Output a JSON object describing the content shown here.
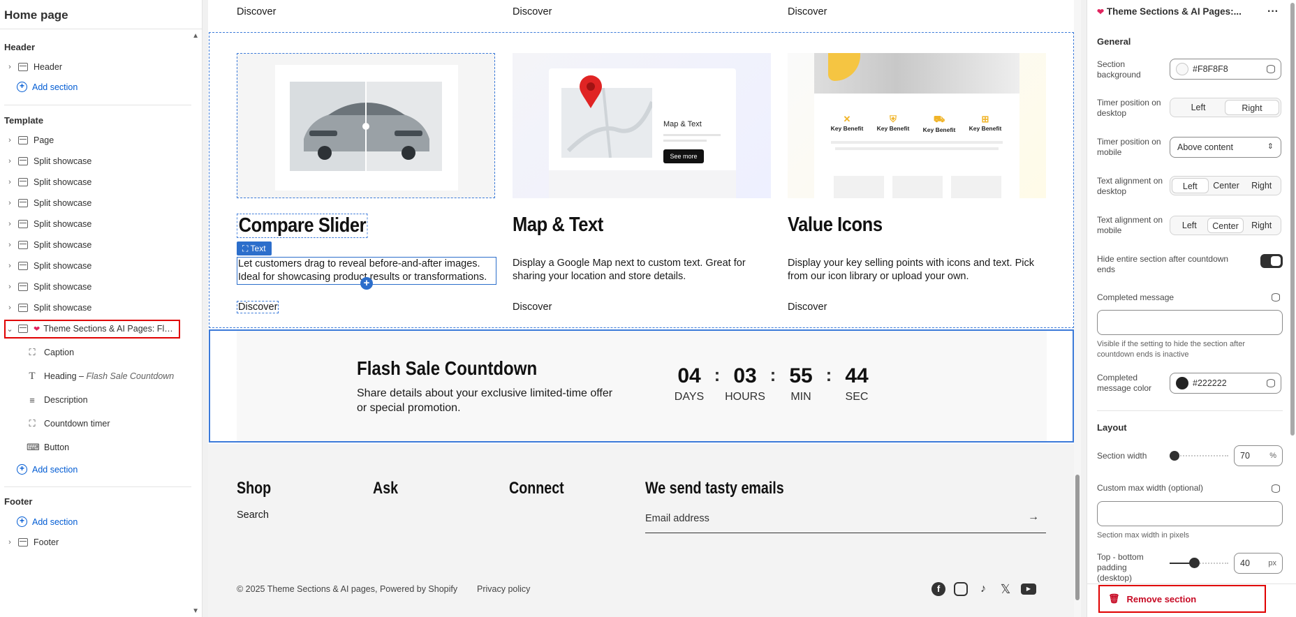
{
  "sidebar": {
    "title": "Home page",
    "header_group": "Header",
    "header_item": "Header",
    "template_group": "Template",
    "page_item": "Page",
    "split_label": "Split showcase",
    "selected_section": "Theme Sections & AI Pages: Fla...",
    "children": {
      "caption": "Caption",
      "heading": "Heading",
      "heading_sub": "Flash Sale Countdown",
      "description": "Description",
      "countdown": "Countdown timer",
      "button": "Button"
    },
    "add_section": "Add section",
    "footer_group": "Footer",
    "footer_item": "Footer"
  },
  "canvas": {
    "discover": "Discover",
    "cards": [
      {
        "title": "Compare Slider",
        "desc": "Let customers drag to reveal before-and-after images. Ideal for showcasing product results or transformations."
      },
      {
        "title": "Map & Text",
        "desc": "Display a Google Map next to custom text. Great for sharing your location and store details."
      },
      {
        "title": "Value Icons",
        "desc": "Display your key selling points with icons and text. Pick from our icon library or upload your own."
      }
    ],
    "text_badge": "Text",
    "map_card": {
      "heading": "Map & Text",
      "button": "See more"
    },
    "benefit_label": "Key Benefit",
    "flash": {
      "heading": "Flash Sale Countdown",
      "desc": "Share details about your exclusive limited-time offer or special promotion.",
      "timer": [
        {
          "value": "04",
          "unit": "DAYS"
        },
        {
          "value": "03",
          "unit": "HOURS"
        },
        {
          "value": "55",
          "unit": "MIN"
        },
        {
          "value": "44",
          "unit": "SEC"
        }
      ],
      "sep": ":"
    },
    "footer": {
      "shop": "Shop",
      "shop_link": "Search",
      "ask": "Ask",
      "connect": "Connect",
      "newsletter": "We send tasty emails",
      "email_placeholder": "Email address",
      "arrow": "→",
      "copyright": "© 2025 Theme Sections & AI pages, Powered by Shopify",
      "privacy": "Privacy policy"
    }
  },
  "panel": {
    "title": "Theme Sections & AI Pages:...",
    "more": "···",
    "general": "General",
    "section_background": "Section background",
    "bg_value": "#F8F8F8",
    "timer_desktop": "Timer position on desktop",
    "timer_desktop_opts": [
      "Left",
      "Right"
    ],
    "timer_desktop_selected": "Right",
    "timer_mobile": "Timer position on mobile",
    "timer_mobile_value": "Above content",
    "align_desktop": "Text alignment on desktop",
    "align_opts": [
      "Left",
      "Center",
      "Right"
    ],
    "align_desktop_selected": "Left",
    "align_mobile": "Text alignment on mobile",
    "align_mobile_selected": "Center",
    "hide_after": "Hide entire section after countdown ends",
    "hide_after_on": true,
    "completed_message": "Completed message",
    "completed_help": "Visible if the setting to hide the section after countdown ends is inactive",
    "completed_color": "Completed message color",
    "completed_color_value": "#222222",
    "layout": "Layout",
    "section_width": "Section width",
    "section_width_value": "70",
    "section_width_unit": "%",
    "custom_max_width": "Custom max width (optional)",
    "max_width_help": "Section max width in pixels",
    "padding": "Top - bottom padding (desktop)",
    "padding_value": "40",
    "padding_unit": "px",
    "remove": "Remove section",
    "colors": {
      "accent": "#005bd3",
      "danger": "#c70a24",
      "bg_swatch": "#F8F8F8",
      "text_swatch": "#222222"
    }
  }
}
